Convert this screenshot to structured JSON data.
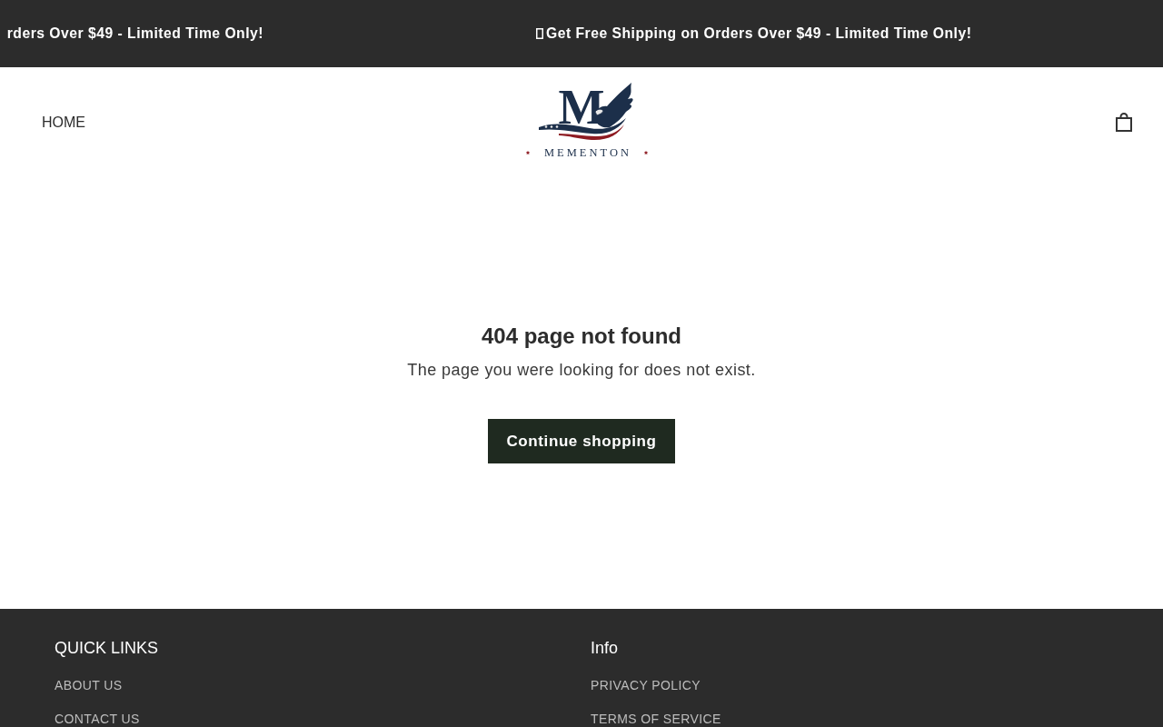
{
  "announcement_bar": {
    "messages": [
      {
        "kind": "partial",
        "text": "rders Over $49 - Limited Time Only!"
      },
      {
        "kind": "full",
        "text": "Get Free Shipping on Orders Over $49 - Limited Time Only!"
      }
    ]
  },
  "header": {
    "nav": [
      {
        "label": "HOME"
      }
    ],
    "logo": {
      "monogram": "M",
      "wordmark": "MEMENTON"
    }
  },
  "main": {
    "title": "404 page not found",
    "message": "The page you were looking for does not exist.",
    "button": "Continue shopping"
  },
  "footer": {
    "columns": [
      {
        "heading": "QUICK LINKS",
        "links": [
          "ABOUT US",
          "CONTACT US"
        ]
      },
      {
        "heading": "Info",
        "links": [
          "PRIVACY POLICY",
          "TERMS OF SERVICE"
        ]
      }
    ]
  }
}
